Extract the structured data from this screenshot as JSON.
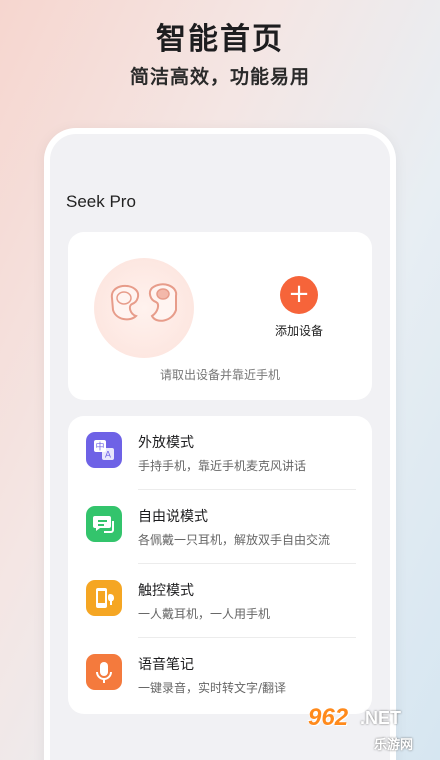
{
  "promo": {
    "headline": "智能首页",
    "subheadline": "简洁高效，功能易用"
  },
  "app": {
    "title": "Seek Pro"
  },
  "device": {
    "add_icon": "plus-icon",
    "add_label": "添加设备",
    "hint": "请取出设备并靠近手机"
  },
  "modes": [
    {
      "title": "外放模式",
      "desc": "手持手机，靠近手机麦克风讲话",
      "icon": "translate-icon",
      "color": "#6e62e6"
    },
    {
      "title": "自由说模式",
      "desc": "各佩戴一只耳机，解放双手自由交流",
      "icon": "chat-icon",
      "color": "#33c46c"
    },
    {
      "title": "触控模式",
      "desc": "一人戴耳机，一人用手机",
      "icon": "phone-earbud-icon",
      "color": "#f5a623"
    },
    {
      "title": "语音笔记",
      "desc": "一键录音，实时转文字/翻译",
      "icon": "microphone-icon",
      "color": "#f47a3d"
    }
  ],
  "watermark": {
    "brand": "962",
    "suffix": ".NET",
    "site": "乐游网"
  },
  "colors": {
    "accent": "#f6643a",
    "card_bg": "#ffffff",
    "screen_bg": "#f1f1f4"
  }
}
